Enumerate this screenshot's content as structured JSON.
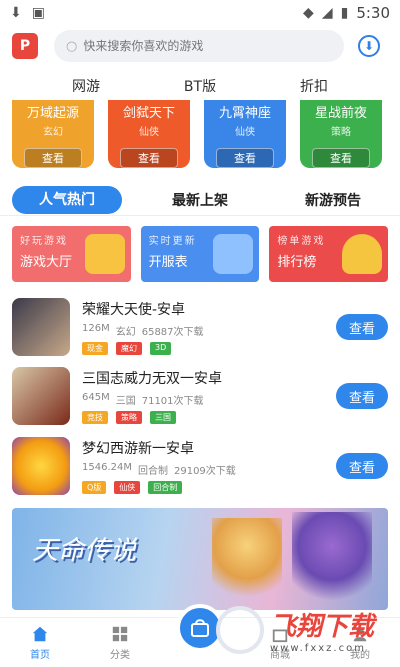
{
  "status_bar": {
    "time": "5:30"
  },
  "search": {
    "placeholder": "快来搜索你喜欢的游戏"
  },
  "top_tabs": [
    "网游",
    "BT版",
    "折扣"
  ],
  "categories": [
    {
      "name": "万域起源",
      "genre": "玄幻",
      "button": "查看",
      "color": "#f0a32c"
    },
    {
      "name": "剑弑天下",
      "genre": "仙侠",
      "button": "查看",
      "color": "#ef5a2a"
    },
    {
      "name": "九霄神座",
      "genre": "仙侠",
      "button": "查看",
      "color": "#3a86e8"
    },
    {
      "name": "星战前夜",
      "genre": "策略",
      "button": "查看",
      "color": "#3cb04c"
    }
  ],
  "section_tabs": [
    "人气热门",
    "最新上架",
    "新游预告"
  ],
  "banners": [
    {
      "sub": "好玩游戏",
      "title": "游戏大厅",
      "color": "#f26e6e"
    },
    {
      "sub": "实时更新",
      "title": "开服表",
      "color": "#4a8ff0"
    },
    {
      "sub": "榜单游戏",
      "title": "排行榜",
      "color": "#ec4b4b"
    }
  ],
  "games": [
    {
      "name": "荣耀大天使-安卓",
      "size": "126M",
      "genre": "玄幻",
      "downloads": "65887次下载",
      "tags": [
        "现金",
        "魔幻",
        "3D"
      ],
      "button": "查看"
    },
    {
      "name": "三国志威力无双一安卓",
      "size": "645M",
      "genre": "三国",
      "downloads": "71101次下载",
      "tags": [
        "竞技",
        "策略",
        "三国"
      ],
      "button": "查看"
    },
    {
      "name": "梦幻西游新一安卓",
      "size": "1546.24M",
      "genre": "回合制",
      "downloads": "29109次下载",
      "tags": [
        "Q版",
        "仙侠",
        "回合制"
      ],
      "button": "查看"
    }
  ],
  "feature_banner": {
    "title": "天命传说"
  },
  "bottom_nav": [
    "首页",
    "分类",
    "",
    "商城",
    "我的"
  ],
  "watermark": {
    "cn": "飞翔下载",
    "en": "www.fxxz.com"
  }
}
